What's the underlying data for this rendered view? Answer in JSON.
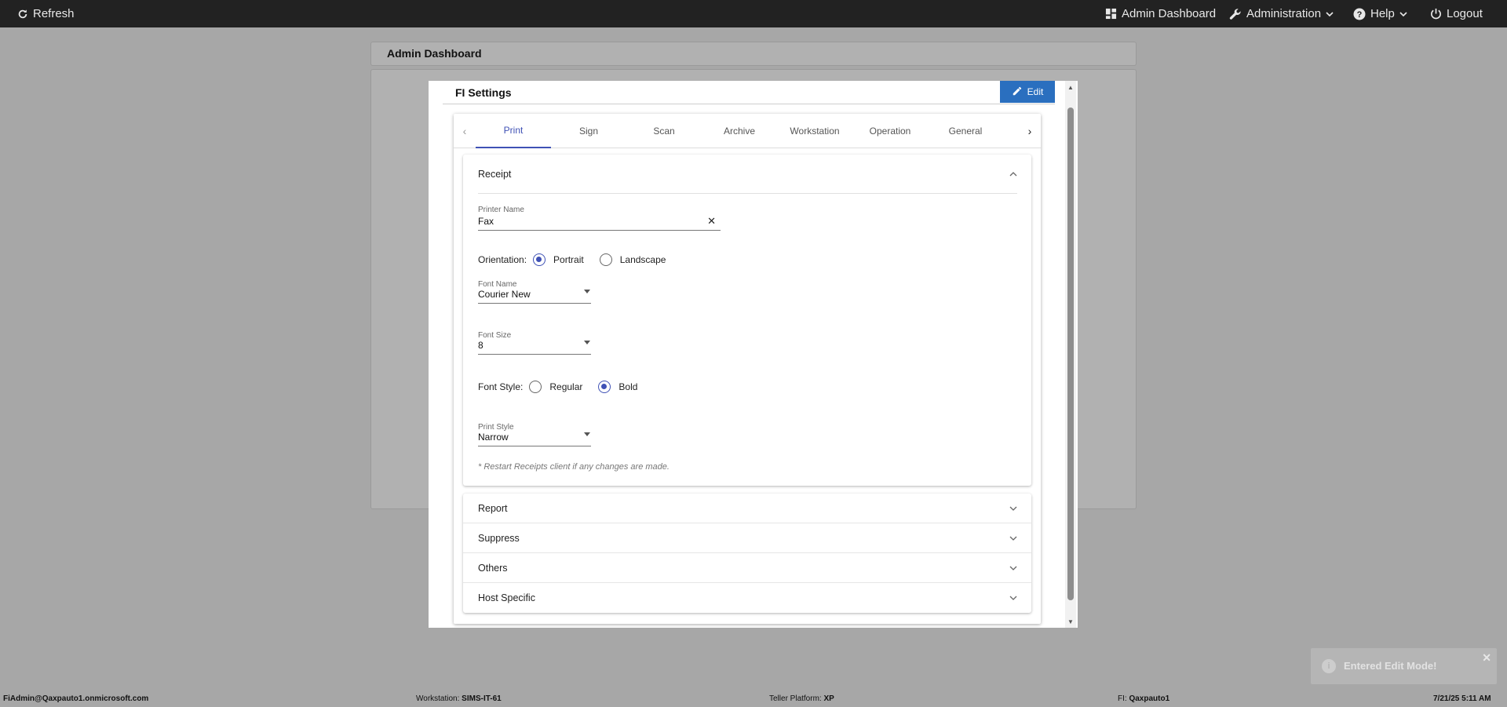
{
  "nav": {
    "refresh": "Refresh",
    "admin_dashboard": "Admin Dashboard",
    "administration": "Administration",
    "help": "Help",
    "logout": "Logout"
  },
  "background": {
    "card_title": "Admin Dashboard"
  },
  "modal": {
    "title": "FI Settings",
    "edit_label": "Edit",
    "tabs": [
      "Print",
      "Sign",
      "Scan",
      "Archive",
      "Workstation",
      "Operation",
      "General"
    ],
    "active_tab": "Print",
    "receipt": {
      "title": "Receipt",
      "printer_name_label": "Printer Name",
      "printer_name_value": "Fax",
      "orientation_label": "Orientation:",
      "orientation_options": [
        "Portrait",
        "Landscape"
      ],
      "orientation_selected": "Portrait",
      "font_name_label": "Font Name",
      "font_name_value": "Courier New",
      "font_size_label": "Font Size",
      "font_size_value": "8",
      "font_style_label": "Font Style:",
      "font_style_options": [
        "Regular",
        "Bold"
      ],
      "font_style_selected": "Bold",
      "print_style_label": "Print Style",
      "print_style_value": "Narrow",
      "note": "* Restart Receipts client if any changes are made."
    },
    "sections": [
      "Report",
      "Suppress",
      "Others",
      "Host Specific"
    ]
  },
  "toast": {
    "message": "Entered Edit Mode!"
  },
  "footer": {
    "user": "FiAdmin@Qaxpauto1.onmicrosoft.com",
    "workstation_label": "Workstation:",
    "workstation_value": "SIMS-IT-61",
    "platform_label": "Teller Platform:",
    "platform_value": "XP",
    "fi_label": "FI:",
    "fi_value": "Qaxpauto1",
    "datetime": "7/21/25 5:11 AM"
  },
  "colors": {
    "accent": "#3f51b5",
    "edit_button": "#2a6fbf",
    "topbar": "#222222"
  }
}
